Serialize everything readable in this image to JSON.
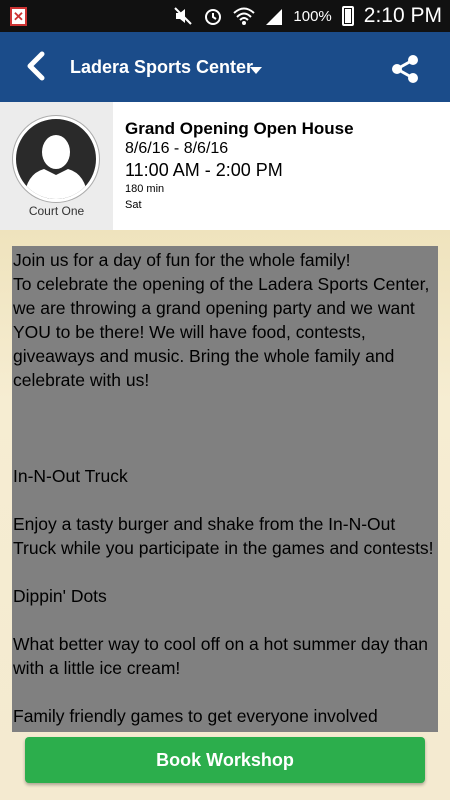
{
  "status_bar": {
    "battery": "100%",
    "time": "2:10 PM",
    "icons": [
      "notification-icon",
      "mute-icon",
      "alarm-icon",
      "wifi-icon",
      "signal-icon",
      "battery-icon"
    ]
  },
  "app_bar": {
    "title": "Ladera Sports Center",
    "color": "#1b4c8a"
  },
  "event": {
    "court": "Court One",
    "title": "Grand Opening Open House",
    "dates": "8/6/16 - 8/6/16",
    "time": "11:00 AM - 2:00 PM",
    "duration": "180 min",
    "day": "Sat",
    "description": "Join us for a day of fun for the whole family!\nTo celebrate the opening of the Ladera Sports Center, we are throwing a grand opening party and we want YOU to be there! We will have food, contests, giveaways and music. Bring the whole family and celebrate with us!\n\n\n\nIn-N-Out Truck\n\nEnjoy a tasty burger and shake from the In-N-Out Truck while you participate in the games and contests!\n\nDippin' Dots\n\nWhat better way to cool off on a hot summer day than with a little ice cream!\n\nFamily friendly games to get everyone involved"
  },
  "actions": {
    "book_label": "Book Workshop",
    "book_color": "#2cae4c"
  }
}
